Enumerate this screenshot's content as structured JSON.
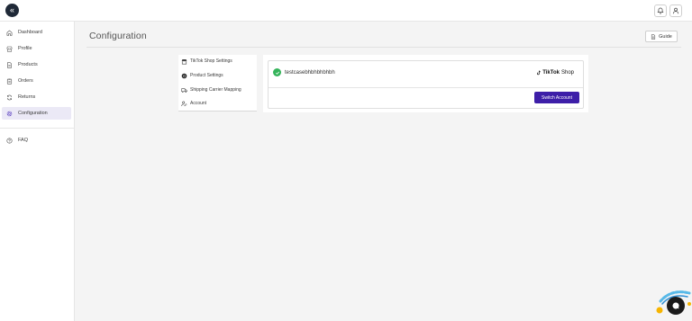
{
  "topbar": {
    "logo_icon": "chevrons-left-icon",
    "notification_icon": "bell-icon",
    "user_icon": "user-icon"
  },
  "sidebar": {
    "items": [
      {
        "label": "Dashboard",
        "icon": "home-icon",
        "active": false
      },
      {
        "label": "Profile",
        "icon": "store-icon",
        "active": false
      },
      {
        "label": "Products",
        "icon": "document-icon",
        "active": false
      },
      {
        "label": "Orders",
        "icon": "clipboard-icon",
        "active": false
      },
      {
        "label": "Returns",
        "icon": "refresh-icon",
        "active": false
      },
      {
        "label": "Configuration",
        "icon": "gear-icon",
        "active": true
      }
    ],
    "secondary_items": [
      {
        "label": "FAQ",
        "icon": "help-circle-icon"
      }
    ]
  },
  "header": {
    "title": "Configuration",
    "guide_label": "Guide"
  },
  "settings_menu": {
    "items": [
      {
        "label": "TikTok Shop Settings",
        "icon": "shop-icon"
      },
      {
        "label": "Product Settings",
        "icon": "box-icon"
      },
      {
        "label": "Shipping Carrier Mapping",
        "icon": "truck-icon"
      },
      {
        "label": "Account",
        "icon": "user-edit-icon"
      }
    ]
  },
  "account": {
    "shop_name": "testcasebhbhbhbhbh",
    "status_icon": "check-circle-icon",
    "brand_logo": {
      "word1": "TikTok",
      "word2": "Shop"
    },
    "switch_label": "Switch Account"
  },
  "colors": {
    "accent": "#3d1ea8",
    "active_nav_bg": "#ebe9f6",
    "success": "#35b35a"
  },
  "chat_widget": {
    "icon": "chat-icon"
  }
}
